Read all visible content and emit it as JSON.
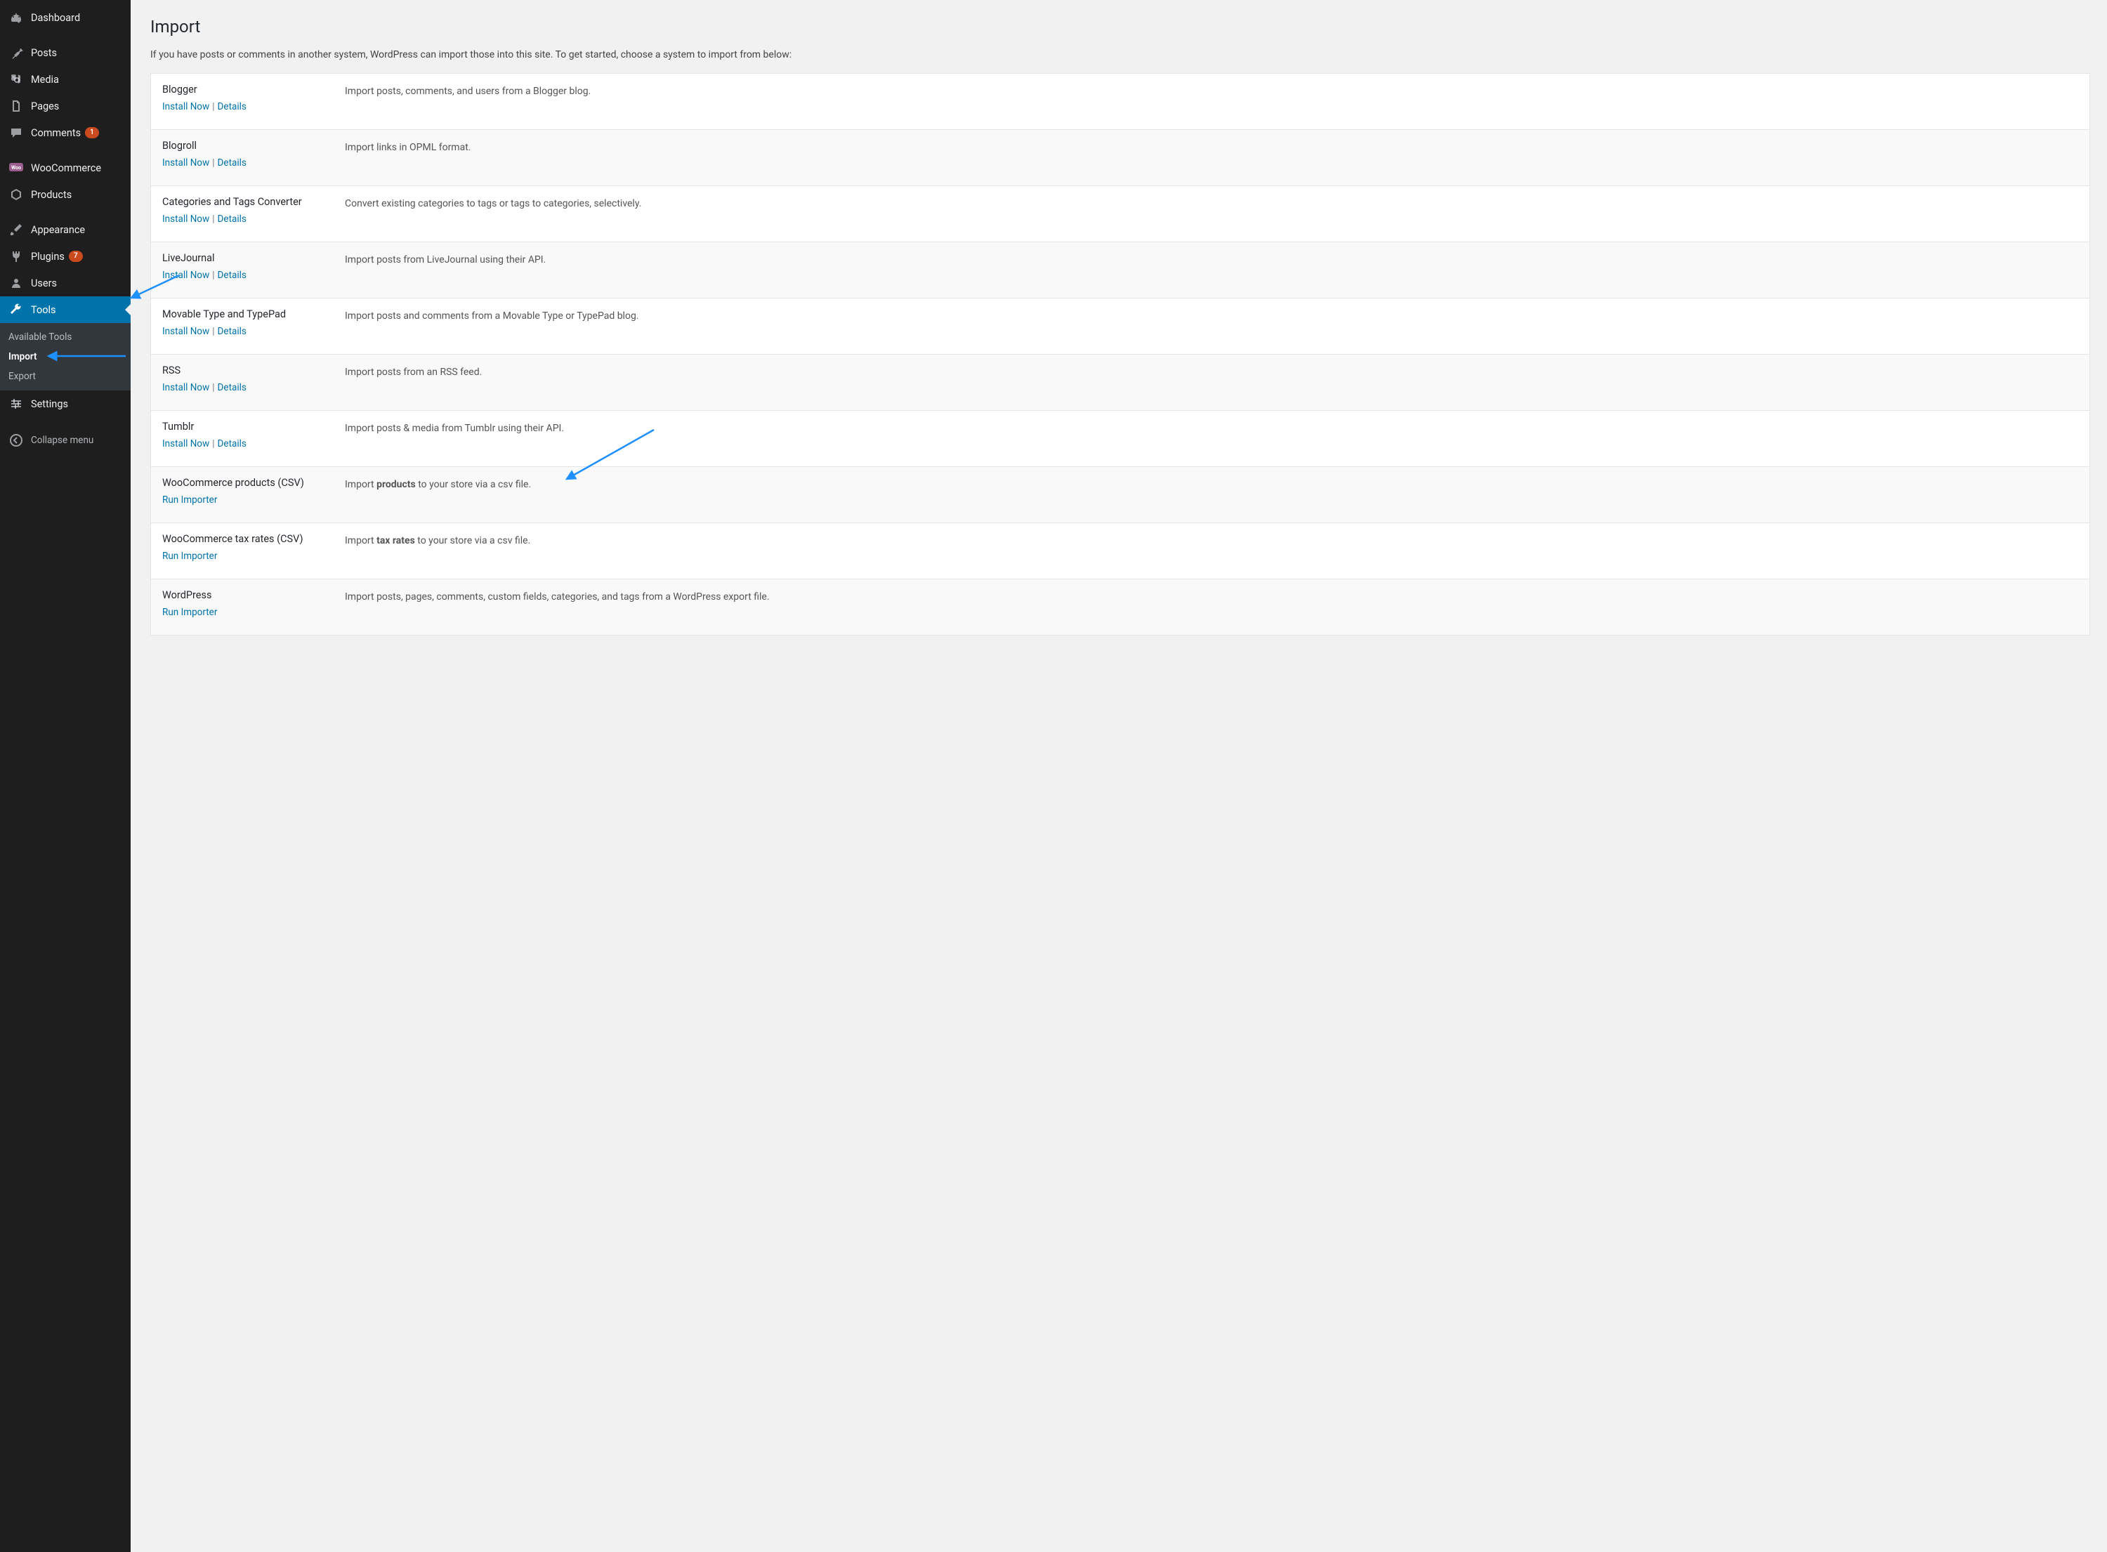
{
  "sidebar": {
    "items": [
      {
        "label": "Dashboard",
        "icon": "dashboard"
      },
      {
        "label": "Posts",
        "icon": "pin"
      },
      {
        "label": "Media",
        "icon": "media"
      },
      {
        "label": "Pages",
        "icon": "pages"
      },
      {
        "label": "Comments",
        "icon": "comment",
        "badge": "1"
      },
      {
        "label": "WooCommerce",
        "icon": "woo"
      },
      {
        "label": "Products",
        "icon": "products"
      },
      {
        "label": "Appearance",
        "icon": "brush"
      },
      {
        "label": "Plugins",
        "icon": "plugin",
        "badge": "7"
      },
      {
        "label": "Users",
        "icon": "user"
      },
      {
        "label": "Tools",
        "icon": "wrench",
        "active": true
      },
      {
        "label": "Settings",
        "icon": "settings"
      }
    ],
    "submenu": [
      {
        "label": "Available Tools"
      },
      {
        "label": "Import",
        "current": true
      },
      {
        "label": "Export"
      }
    ],
    "collapse_label": "Collapse menu"
  },
  "page": {
    "title": "Import",
    "intro": "If you have posts or comments in another system, WordPress can import those into this site. To get started, choose a system to import from below:"
  },
  "labels": {
    "install_now": "Install Now",
    "details": "Details",
    "run_importer": "Run Importer"
  },
  "importers": [
    {
      "title": "Blogger",
      "desc": "Import posts, comments, and users from a Blogger blog.",
      "action": "install"
    },
    {
      "title": "Blogroll",
      "desc": "Import links in OPML format.",
      "action": "install"
    },
    {
      "title": "Categories and Tags Converter",
      "desc": "Convert existing categories to tags or tags to categories, selectively.",
      "action": "install"
    },
    {
      "title": "LiveJournal",
      "desc": "Import posts from LiveJournal using their API.",
      "action": "install"
    },
    {
      "title": "Movable Type and TypePad",
      "desc": "Import posts and comments from a Movable Type or TypePad blog.",
      "action": "install"
    },
    {
      "title": "RSS",
      "desc": "Import posts from an RSS feed.",
      "action": "install"
    },
    {
      "title": "Tumblr",
      "desc": "Import posts & media from Tumblr using their API.",
      "action": "install"
    },
    {
      "title": "WooCommerce products (CSV)",
      "desc_pre": "Import ",
      "desc_bold": "products",
      "desc_post": " to your store via a csv file.",
      "action": "run"
    },
    {
      "title": "WooCommerce tax rates (CSV)",
      "desc_pre": "Import ",
      "desc_bold": "tax rates",
      "desc_post": " to your store via a csv file.",
      "action": "run"
    },
    {
      "title": "WordPress",
      "desc": "Import posts, pages, comments, custom fields, categories, and tags from a WordPress export file.",
      "action": "run"
    }
  ]
}
